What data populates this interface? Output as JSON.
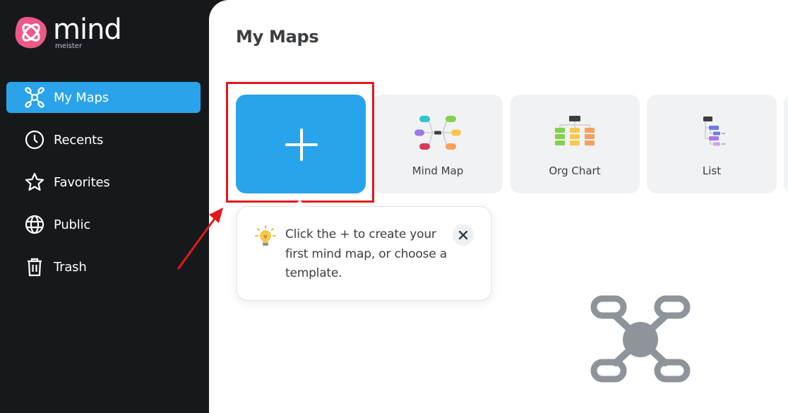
{
  "brand": {
    "name": "mind",
    "sub": "meister",
    "color": "#f0588a"
  },
  "sidebar": {
    "items": [
      {
        "label": "My Maps",
        "icon": "map-network-icon",
        "active": true
      },
      {
        "label": "Recents",
        "icon": "clock-icon",
        "active": false
      },
      {
        "label": "Favorites",
        "icon": "star-icon",
        "active": false
      },
      {
        "label": "Public",
        "icon": "globe-icon",
        "active": false
      },
      {
        "label": "Trash",
        "icon": "trash-icon",
        "active": false
      }
    ]
  },
  "main": {
    "title": "My Maps",
    "cards": [
      {
        "label": "",
        "icon": "plus-icon"
      },
      {
        "label": "Mind Map",
        "icon": "mind-map-template-icon"
      },
      {
        "label": "Org Chart",
        "icon": "org-chart-template-icon"
      },
      {
        "label": "List",
        "icon": "list-template-icon"
      }
    ]
  },
  "tooltip": {
    "text": "Click the + to create your first mind map, or choose a template.",
    "icon": "lightbulb-icon"
  },
  "colors": {
    "accent": "#27a4ec",
    "sidebar_bg": "#16191c",
    "highlight": "#e3171d"
  }
}
